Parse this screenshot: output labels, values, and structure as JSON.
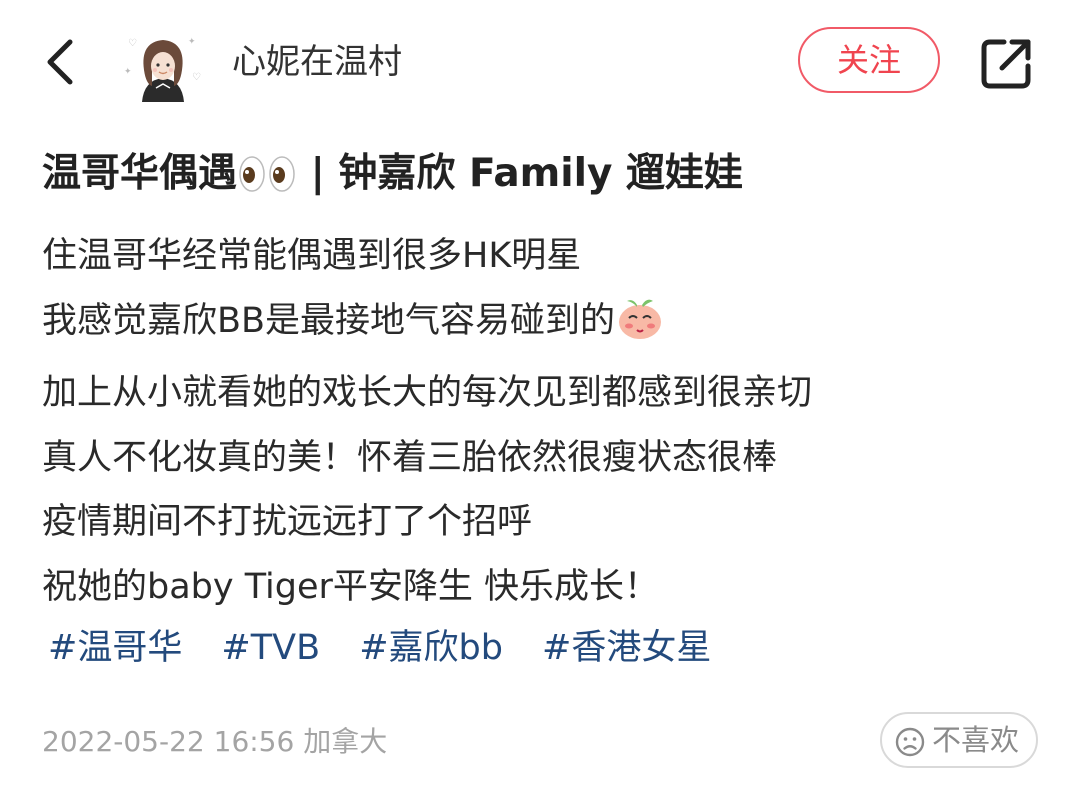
{
  "header": {
    "back_icon": "chevron-left-icon",
    "author_name": "心妮在温村",
    "follow_label": "关注",
    "follow_color": "#f0444f",
    "share_icon": "share-external-icon"
  },
  "post": {
    "title_part1": "温哥华偶遇",
    "title_emoji": "eyes-emoji",
    "title_part2": " | 钟嘉欣 Family 遛娃娃",
    "lines": [
      "住温哥华经常能偶遇到很多HK明星",
      "我感觉嘉欣BB是最接地气容易碰到的",
      "加上从小就看她的戏长大的每次见到都感到很亲切",
      "真人不化妆真的美！怀着三胎依然很瘦状态很棒",
      "疫情期间不打扰远远打了个招呼",
      "祝她的baby Tiger平安降生 快乐成长！"
    ],
    "line2_emoji": "peach-blush-emoji",
    "tags": [
      "#温哥华",
      "#TVB",
      "#嘉欣bb",
      "#香港女星"
    ],
    "tag_color": "#234a7d"
  },
  "footer": {
    "meta": "2022-05-22 16:56 加拿大",
    "dislike_label": "不喜欢",
    "dislike_icon": "sad-face-icon"
  }
}
